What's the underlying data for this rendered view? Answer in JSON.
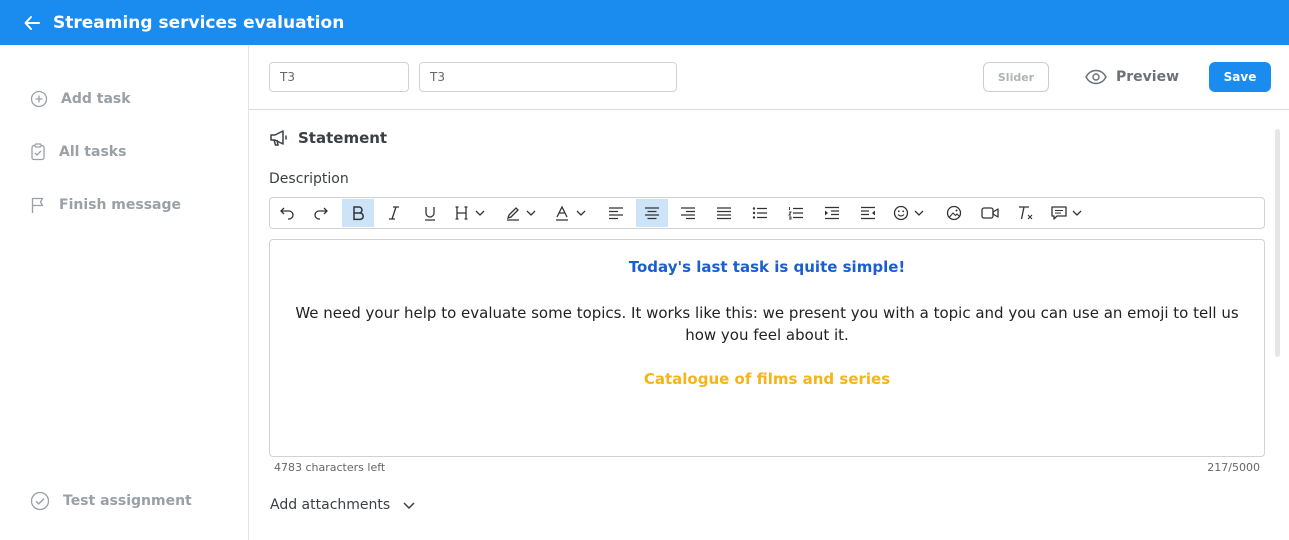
{
  "header": {
    "title": "Streaming services evaluation"
  },
  "sidebar": {
    "items": [
      {
        "label": "Add task",
        "icon": "plus-circle-icon"
      },
      {
        "label": "All tasks",
        "icon": "clipboard-check-icon"
      },
      {
        "label": "Finish message",
        "icon": "flag-icon"
      }
    ],
    "test_assignment": {
      "label": "Test assignment",
      "icon": "check-circle-icon"
    }
  },
  "task": {
    "short_name": "T3",
    "name": "T3",
    "slider_label": "Slider",
    "preview_label": "Preview",
    "save_label": "Save"
  },
  "statement": {
    "title": "Statement",
    "description_label": "Description",
    "editor": {
      "heading": "Today's last task is quite simple!",
      "body": "We need your help to evaluate some topics.  It works like this: we present you with a topic and you can use an emoji to tell us how you feel about it.",
      "catalogue": "Catalogue of films and series"
    },
    "chars_left": "4783 characters left",
    "char_count": "217/5000",
    "attachments_label": "Add attachments"
  },
  "colors": {
    "accent": "#1a8cf0",
    "heading_text": "#1a5fd0",
    "catalogue_text": "#f5b41a",
    "active_tool": "#cde4f8"
  }
}
